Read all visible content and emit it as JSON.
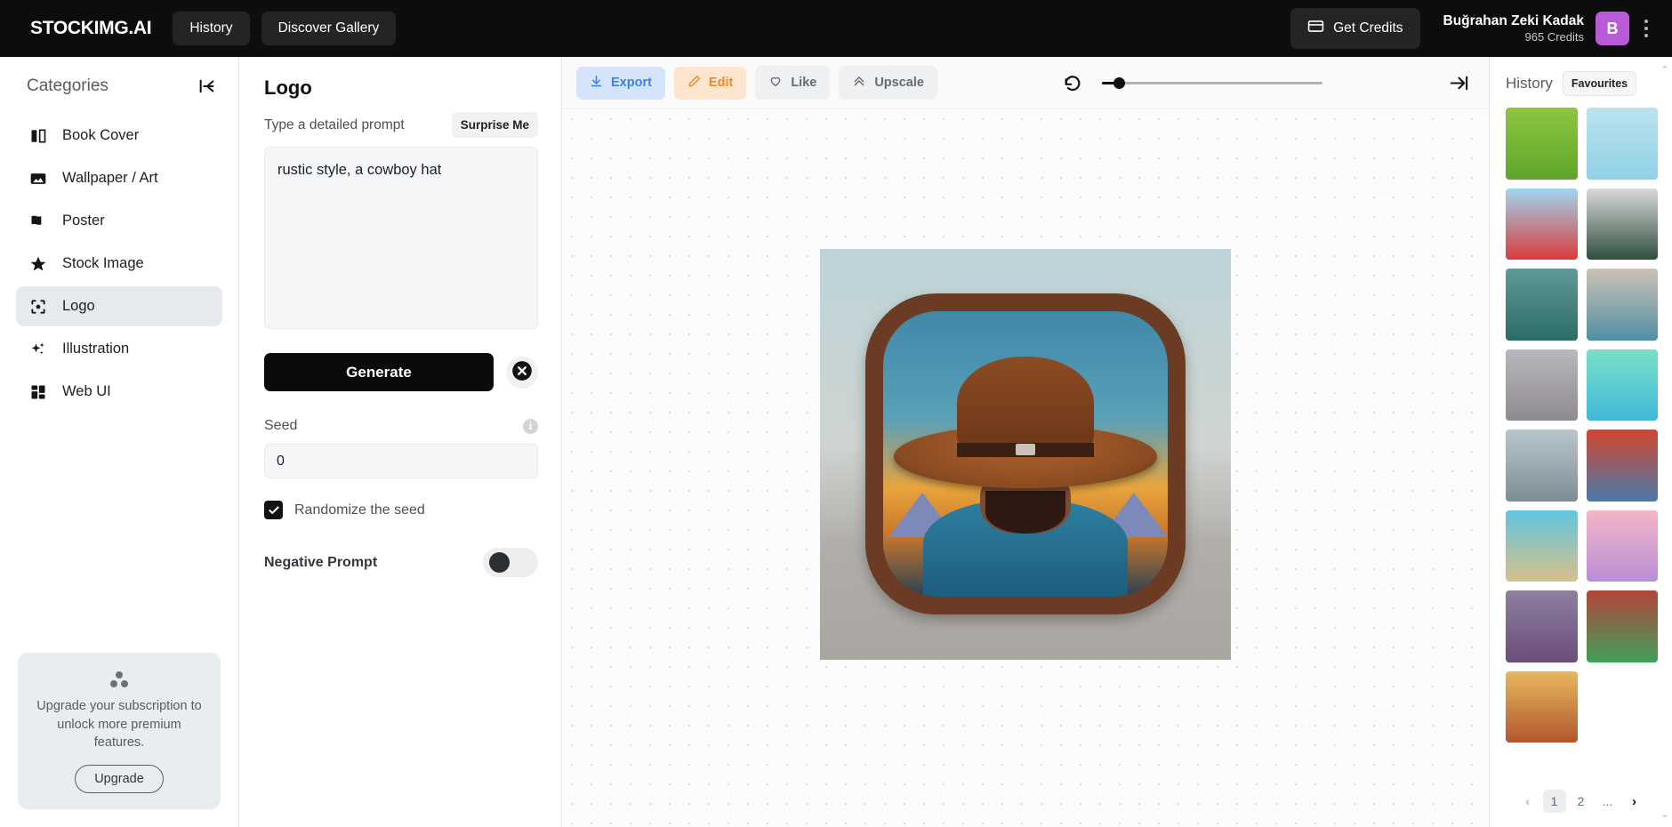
{
  "topbar": {
    "brand": "STOCKIMG.AI",
    "nav": [
      {
        "label": "History",
        "name": "nav-history"
      },
      {
        "label": "Discover Gallery",
        "name": "nav-discover-gallery"
      }
    ],
    "get_credits_label": "Get Credits",
    "user_name": "Buğrahan Zeki Kadak",
    "user_credits": "965 Credits",
    "avatar_initial": "B",
    "bg_color": "#0d0d0d",
    "avatar_color": "#b95ad6"
  },
  "sidebar": {
    "title": "Categories",
    "items": [
      {
        "label": "Book Cover",
        "icon": "book-icon",
        "active": false
      },
      {
        "label": "Wallpaper / Art",
        "icon": "image-icon",
        "active": false
      },
      {
        "label": "Poster",
        "icon": "flag-icon",
        "active": false
      },
      {
        "label": "Stock Image",
        "icon": "star-icon",
        "active": false
      },
      {
        "label": "Logo",
        "icon": "focus-dot-icon",
        "active": true
      },
      {
        "label": "Illustration",
        "icon": "sparkles-icon",
        "active": false
      },
      {
        "label": "Web UI",
        "icon": "grid-icon",
        "active": false
      }
    ],
    "upgrade": {
      "text": "Upgrade your subscription to unlock more premium features.",
      "button": "Upgrade"
    }
  },
  "prompt_panel": {
    "title": "Logo",
    "prompt_label": "Type a detailed prompt",
    "surprise_label": "Surprise Me",
    "prompt_value": "rustic style, a cowboy hat",
    "prompt_placeholder": "Type a detailed prompt",
    "generate_label": "Generate",
    "seed_label": "Seed",
    "seed_value": "0",
    "seed_placeholder": "0",
    "randomize_label": "Randomize the seed",
    "randomize_checked": true,
    "negative_prompt_label": "Negative Prompt",
    "negative_prompt_on": false
  },
  "canvas": {
    "tools": [
      {
        "label": "Export",
        "icon": "download-icon",
        "color": "#3d82e0",
        "bg": "#d3e4fb"
      },
      {
        "label": "Edit",
        "icon": "pencil-icon",
        "color": "#e98a2b",
        "bg": "#fde6cd"
      },
      {
        "label": "Like",
        "icon": "heart-icon",
        "color": "#656b72",
        "bg": "#eff0f1"
      },
      {
        "label": "Upscale",
        "icon": "chevrons-up-icon",
        "color": "#656b72",
        "bg": "#eff0f1"
      }
    ],
    "slider_value": 5,
    "image_alt": "Generated logo: rustic cowboy with brown hat, mountain sunset background"
  },
  "history": {
    "title": "History",
    "favourites_label": "Favourites",
    "thumbnails": [
      {
        "name": "thumb-pixel-village",
        "bg": "linear-gradient(#8dc63f,#5ea52c)"
      },
      {
        "name": "thumb-burger-red",
        "bg": "linear-gradient(#bde3ee,#8fd0e6)"
      },
      {
        "name": "thumb-burger-blue",
        "bg": "linear-gradient(#9fd6ef,#d93b3b)"
      },
      {
        "name": "thumb-sword-emblem",
        "bg": "linear-gradient(#d9d9d9,#2f4f3f)"
      },
      {
        "name": "thumb-mushroom-knight",
        "bg": "linear-gradient(#5e9b98,#2d6b66)"
      },
      {
        "name": "thumb-eiffel-tower",
        "bg": "linear-gradient(#cdc2b5,#4f8fa3)"
      },
      {
        "name": "thumb-dessert-plate",
        "bg": "linear-gradient(#b9b7bd,#8e8a90)"
      },
      {
        "name": "thumb-sandwich-mint",
        "bg": "linear-gradient(#79e0c6,#3fb8d9)"
      },
      {
        "name": "thumb-red-car",
        "bg": "linear-gradient(#b9c6cd,#7d8d96)"
      },
      {
        "name": "thumb-blue-truck",
        "bg": "linear-gradient(#d2452f,#4a7ba8)"
      },
      {
        "name": "thumb-teal-car",
        "bg": "linear-gradient(#5fc6e0,#d8c08a)"
      },
      {
        "name": "thumb-pilot-avatar",
        "bg": "linear-gradient(#f3b6c6,#b98ed6)"
      },
      {
        "name": "thumb-purple-portrait",
        "bg": "linear-gradient(#8f7fa0,#6b4d7a)"
      },
      {
        "name": "thumb-burger-flag",
        "bg": "linear-gradient(#b5453a,#3ea05a)"
      },
      {
        "name": "thumb-cowboy-hat",
        "bg": "linear-gradient(#e8b85e,#b0562d)"
      }
    ],
    "pagination": {
      "prev": "‹",
      "pages": [
        "1",
        "2"
      ],
      "ellipsis": "...",
      "next": "›",
      "current": "1"
    }
  }
}
